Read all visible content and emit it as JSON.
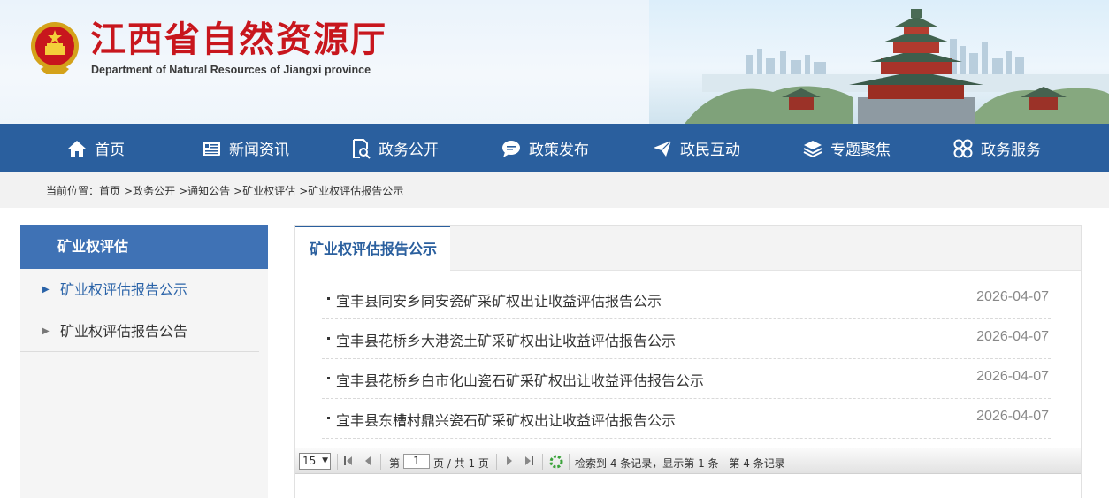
{
  "header": {
    "title": "江西省自然资源厅",
    "subtitle": "Department of Natural Resources of Jiangxi province",
    "emblem_icon": "national-emblem-icon"
  },
  "nav": {
    "items": [
      {
        "label": "首页",
        "icon": "home-icon"
      },
      {
        "label": "新闻资讯",
        "icon": "news-icon"
      },
      {
        "label": "政务公开",
        "icon": "document-search-icon"
      },
      {
        "label": "政策发布",
        "icon": "chat-bubble-icon"
      },
      {
        "label": "政民互动",
        "icon": "paper-plane-icon"
      },
      {
        "label": "专题聚焦",
        "icon": "layers-icon"
      },
      {
        "label": "政务服务",
        "icon": "grid-rings-icon"
      }
    ]
  },
  "breadcrumb": {
    "prefix": "当前位置：",
    "items": [
      "首页",
      ">政务公开",
      ">通知公告",
      ">矿业权评估",
      ">矿业权评估报告公示"
    ]
  },
  "sidebar": {
    "title": "矿业权评估",
    "items": [
      {
        "label": "矿业权评估报告公示",
        "active": true
      },
      {
        "label": "矿业权评估报告公告",
        "active": false
      }
    ]
  },
  "main": {
    "tab": "矿业权评估报告公示",
    "rows": [
      {
        "title": "宜丰县同安乡同安瓷矿采矿权出让收益评估报告公示",
        "date": "2026-04-07"
      },
      {
        "title": "宜丰县花桥乡大港瓷土矿采矿权出让收益评估报告公示",
        "date": "2026-04-07"
      },
      {
        "title": "宜丰县花桥乡白市化山瓷石矿采矿权出让收益评估报告公示",
        "date": "2026-04-07"
      },
      {
        "title": "宜丰县东槽村鼎兴瓷石矿采矿权出让收益评估报告公示",
        "date": "2026-04-07"
      }
    ]
  },
  "pager": {
    "page_size": "15",
    "page_label_pre": "第",
    "current_page": "1",
    "page_label_post": "页 / 共 1 页",
    "summary": "检索到 4 条记录，显示第 1 条 - 第 4 条记录"
  },
  "colors": {
    "nav_bg": "#2a5f9e",
    "title_red": "#c8161d",
    "sidebar_head": "#3f72b5",
    "active_link": "#2a63a8"
  }
}
